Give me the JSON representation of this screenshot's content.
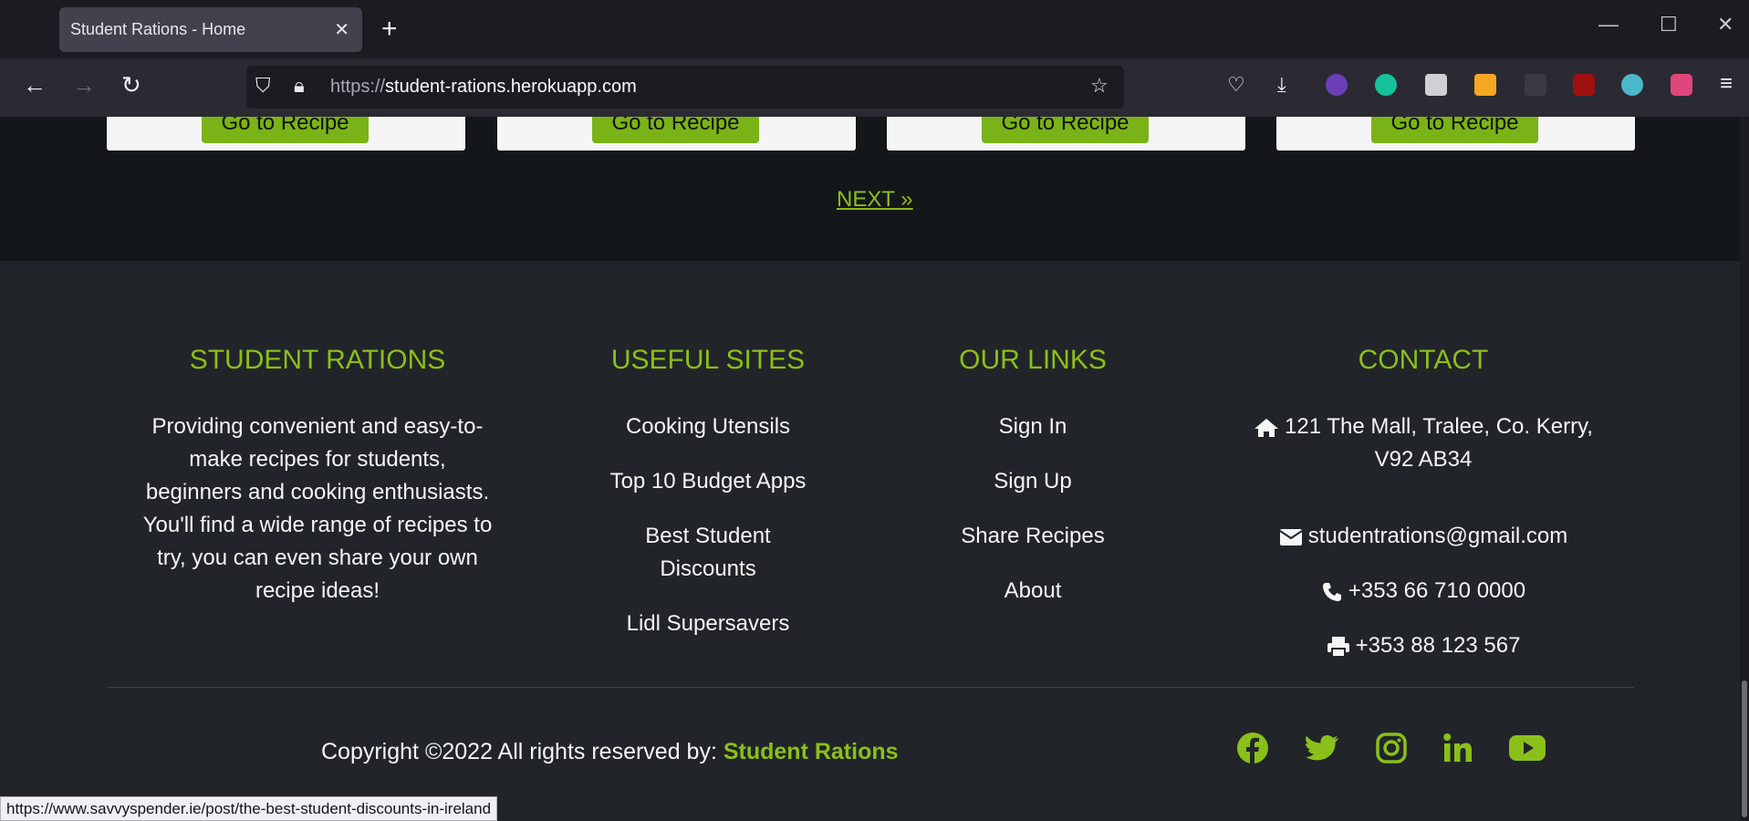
{
  "browser": {
    "tab_title": "Student Rations - Home",
    "url_scheme": "https://",
    "url_host": "student-rations.herokuapp.com",
    "status_url": "https://www.savvyspender.ie/post/the-best-student-discounts-in-ireland"
  },
  "cards": {
    "button_label": "Go to Recipe"
  },
  "pagination": {
    "next_label": "NEXT »"
  },
  "footer": {
    "about": {
      "heading": "STUDENT RATIONS",
      "text": "Providing convenient and easy-to-make recipes for students, beginners and cooking enthusiasts. You'll find a wide range of recipes to try, you can even share your own recipe ideas!"
    },
    "useful_sites": {
      "heading": "USEFUL SITES",
      "links": [
        "Cooking Utensils",
        "Top 10 Budget Apps",
        "Best Student Discounts",
        "Lidl Supersavers"
      ]
    },
    "our_links": {
      "heading": "OUR LINKS",
      "links": [
        "Sign In",
        "Sign Up",
        "Share Recipes",
        "About"
      ]
    },
    "contact": {
      "heading": "CONTACT",
      "address": "121 The Mall, Tralee, Co. Kerry, V92 AB34",
      "email": "studentrations@gmail.com",
      "phone": "+353 66 710 0000",
      "fax": "+353 88 123 567"
    },
    "copyright_prefix": "Copyright ©2022 All rights reserved by: ",
    "copyright_name": "Student Rations",
    "social": [
      "facebook-icon",
      "twitter-icon",
      "instagram-icon",
      "linkedin-icon",
      "youtube-icon"
    ]
  },
  "colors": {
    "accent": "#8bbf1a",
    "button": "#7ab317",
    "footer_bg": "#212529"
  }
}
